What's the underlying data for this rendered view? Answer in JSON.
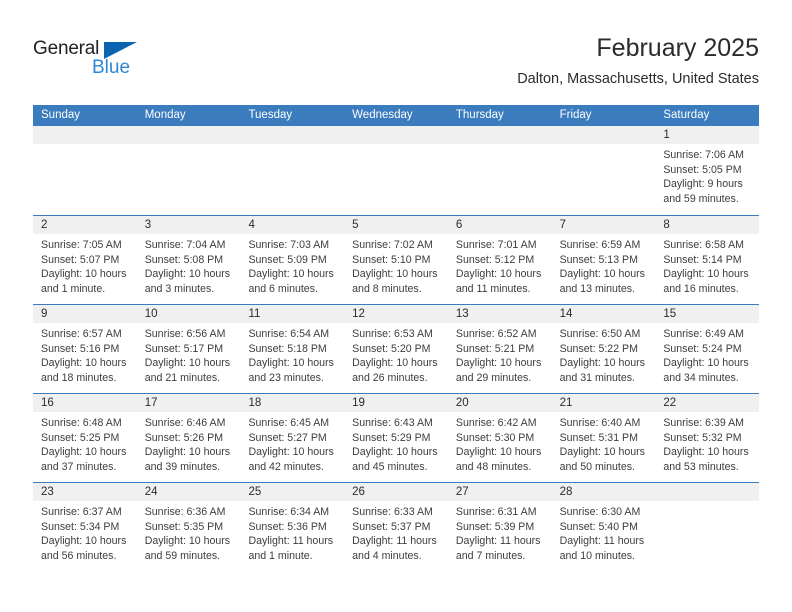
{
  "brand": {
    "name_top": "General",
    "name_bottom": "Blue",
    "triangle_color": "#0c64b0",
    "blue_color": "#2e86d4"
  },
  "header": {
    "title": "February 2025",
    "subtitle": "Dalton, Massachusetts, United States"
  },
  "theme": {
    "header_blue": "#3a7cbe",
    "day_number_band": "#f0f0f0",
    "text": "#3d3d3d"
  },
  "calendar": {
    "weekdays": [
      "Sunday",
      "Monday",
      "Tuesday",
      "Wednesday",
      "Thursday",
      "Friday",
      "Saturday"
    ],
    "labels": {
      "sunrise": "Sunrise:",
      "sunset": "Sunset:",
      "daylight": "Daylight:"
    },
    "weeks": [
      [
        {
          "day": "",
          "empty": true
        },
        {
          "day": "",
          "empty": true
        },
        {
          "day": "",
          "empty": true
        },
        {
          "day": "",
          "empty": true
        },
        {
          "day": "",
          "empty": true
        },
        {
          "day": "",
          "empty": true
        },
        {
          "day": "1",
          "sunrise": "Sunrise: 7:06 AM",
          "sunset": "Sunset: 5:05 PM",
          "daylight": "Daylight: 9 hours and 59 minutes."
        }
      ],
      [
        {
          "day": "2",
          "sunrise": "Sunrise: 7:05 AM",
          "sunset": "Sunset: 5:07 PM",
          "daylight": "Daylight: 10 hours and 1 minute."
        },
        {
          "day": "3",
          "sunrise": "Sunrise: 7:04 AM",
          "sunset": "Sunset: 5:08 PM",
          "daylight": "Daylight: 10 hours and 3 minutes."
        },
        {
          "day": "4",
          "sunrise": "Sunrise: 7:03 AM",
          "sunset": "Sunset: 5:09 PM",
          "daylight": "Daylight: 10 hours and 6 minutes."
        },
        {
          "day": "5",
          "sunrise": "Sunrise: 7:02 AM",
          "sunset": "Sunset: 5:10 PM",
          "daylight": "Daylight: 10 hours and 8 minutes."
        },
        {
          "day": "6",
          "sunrise": "Sunrise: 7:01 AM",
          "sunset": "Sunset: 5:12 PM",
          "daylight": "Daylight: 10 hours and 11 minutes."
        },
        {
          "day": "7",
          "sunrise": "Sunrise: 6:59 AM",
          "sunset": "Sunset: 5:13 PM",
          "daylight": "Daylight: 10 hours and 13 minutes."
        },
        {
          "day": "8",
          "sunrise": "Sunrise: 6:58 AM",
          "sunset": "Sunset: 5:14 PM",
          "daylight": "Daylight: 10 hours and 16 minutes."
        }
      ],
      [
        {
          "day": "9",
          "sunrise": "Sunrise: 6:57 AM",
          "sunset": "Sunset: 5:16 PM",
          "daylight": "Daylight: 10 hours and 18 minutes."
        },
        {
          "day": "10",
          "sunrise": "Sunrise: 6:56 AM",
          "sunset": "Sunset: 5:17 PM",
          "daylight": "Daylight: 10 hours and 21 minutes."
        },
        {
          "day": "11",
          "sunrise": "Sunrise: 6:54 AM",
          "sunset": "Sunset: 5:18 PM",
          "daylight": "Daylight: 10 hours and 23 minutes."
        },
        {
          "day": "12",
          "sunrise": "Sunrise: 6:53 AM",
          "sunset": "Sunset: 5:20 PM",
          "daylight": "Daylight: 10 hours and 26 minutes."
        },
        {
          "day": "13",
          "sunrise": "Sunrise: 6:52 AM",
          "sunset": "Sunset: 5:21 PM",
          "daylight": "Daylight: 10 hours and 29 minutes."
        },
        {
          "day": "14",
          "sunrise": "Sunrise: 6:50 AM",
          "sunset": "Sunset: 5:22 PM",
          "daylight": "Daylight: 10 hours and 31 minutes."
        },
        {
          "day": "15",
          "sunrise": "Sunrise: 6:49 AM",
          "sunset": "Sunset: 5:24 PM",
          "daylight": "Daylight: 10 hours and 34 minutes."
        }
      ],
      [
        {
          "day": "16",
          "sunrise": "Sunrise: 6:48 AM",
          "sunset": "Sunset: 5:25 PM",
          "daylight": "Daylight: 10 hours and 37 minutes."
        },
        {
          "day": "17",
          "sunrise": "Sunrise: 6:46 AM",
          "sunset": "Sunset: 5:26 PM",
          "daylight": "Daylight: 10 hours and 39 minutes."
        },
        {
          "day": "18",
          "sunrise": "Sunrise: 6:45 AM",
          "sunset": "Sunset: 5:27 PM",
          "daylight": "Daylight: 10 hours and 42 minutes."
        },
        {
          "day": "19",
          "sunrise": "Sunrise: 6:43 AM",
          "sunset": "Sunset: 5:29 PM",
          "daylight": "Daylight: 10 hours and 45 minutes."
        },
        {
          "day": "20",
          "sunrise": "Sunrise: 6:42 AM",
          "sunset": "Sunset: 5:30 PM",
          "daylight": "Daylight: 10 hours and 48 minutes."
        },
        {
          "day": "21",
          "sunrise": "Sunrise: 6:40 AM",
          "sunset": "Sunset: 5:31 PM",
          "daylight": "Daylight: 10 hours and 50 minutes."
        },
        {
          "day": "22",
          "sunrise": "Sunrise: 6:39 AM",
          "sunset": "Sunset: 5:32 PM",
          "daylight": "Daylight: 10 hours and 53 minutes."
        }
      ],
      [
        {
          "day": "23",
          "sunrise": "Sunrise: 6:37 AM",
          "sunset": "Sunset: 5:34 PM",
          "daylight": "Daylight: 10 hours and 56 minutes."
        },
        {
          "day": "24",
          "sunrise": "Sunrise: 6:36 AM",
          "sunset": "Sunset: 5:35 PM",
          "daylight": "Daylight: 10 hours and 59 minutes."
        },
        {
          "day": "25",
          "sunrise": "Sunrise: 6:34 AM",
          "sunset": "Sunset: 5:36 PM",
          "daylight": "Daylight: 11 hours and 1 minute."
        },
        {
          "day": "26",
          "sunrise": "Sunrise: 6:33 AM",
          "sunset": "Sunset: 5:37 PM",
          "daylight": "Daylight: 11 hours and 4 minutes."
        },
        {
          "day": "27",
          "sunrise": "Sunrise: 6:31 AM",
          "sunset": "Sunset: 5:39 PM",
          "daylight": "Daylight: 11 hours and 7 minutes."
        },
        {
          "day": "28",
          "sunrise": "Sunrise: 6:30 AM",
          "sunset": "Sunset: 5:40 PM",
          "daylight": "Daylight: 11 hours and 10 minutes."
        },
        {
          "day": "",
          "empty": true
        }
      ]
    ]
  }
}
